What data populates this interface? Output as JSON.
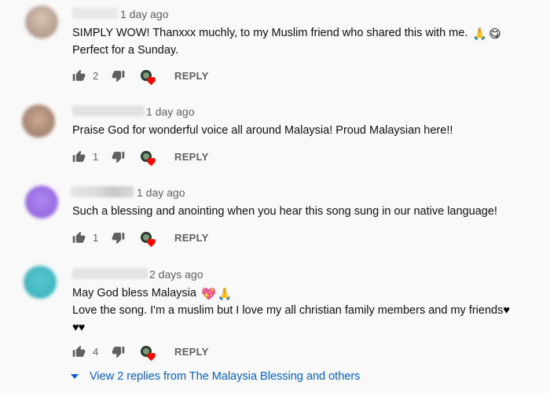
{
  "comments": [
    {
      "avatar_color": "#c9b2a4",
      "time": "1 day ago",
      "lines": [
        "SIMPLY WOW! Thanxxx muchly, to my Muslim friend who shared this with me.",
        "Perfect for a Sunday."
      ],
      "emoji1": "🙏",
      "emoji2": "😋",
      "likes": "2",
      "reply_label": "REPLY"
    },
    {
      "avatar_color": "#b29a88",
      "time": "1 day ago",
      "lines": [
        "Praise God for wonderful voice all around Malaysia! Proud Malaysian here!!"
      ],
      "likes": "1",
      "reply_label": "REPLY"
    },
    {
      "avatar_color": "#9a6fe0",
      "time": "1 day ago",
      "lines": [
        "Such a blessing and anointing when you hear this song sung in our native language!"
      ],
      "likes": "1",
      "reply_label": "REPLY"
    },
    {
      "avatar_color": "#3fb6bf",
      "time": "2 days ago",
      "lines": [
        "May God bless Malaysia",
        "Love the song. I'm a muslim but I love my all christian family members and my friends"
      ],
      "emoji1": "💖",
      "emoji2": "🙏",
      "hearts": "♥",
      "hearts2": "♥♥",
      "likes": "4",
      "reply_label": "REPLY"
    }
  ],
  "view_replies": "View 2 replies from The Malaysia Blessing and others",
  "colors": {
    "link": "#065fd4",
    "meta": "#606060",
    "heart": "#ff0000"
  }
}
